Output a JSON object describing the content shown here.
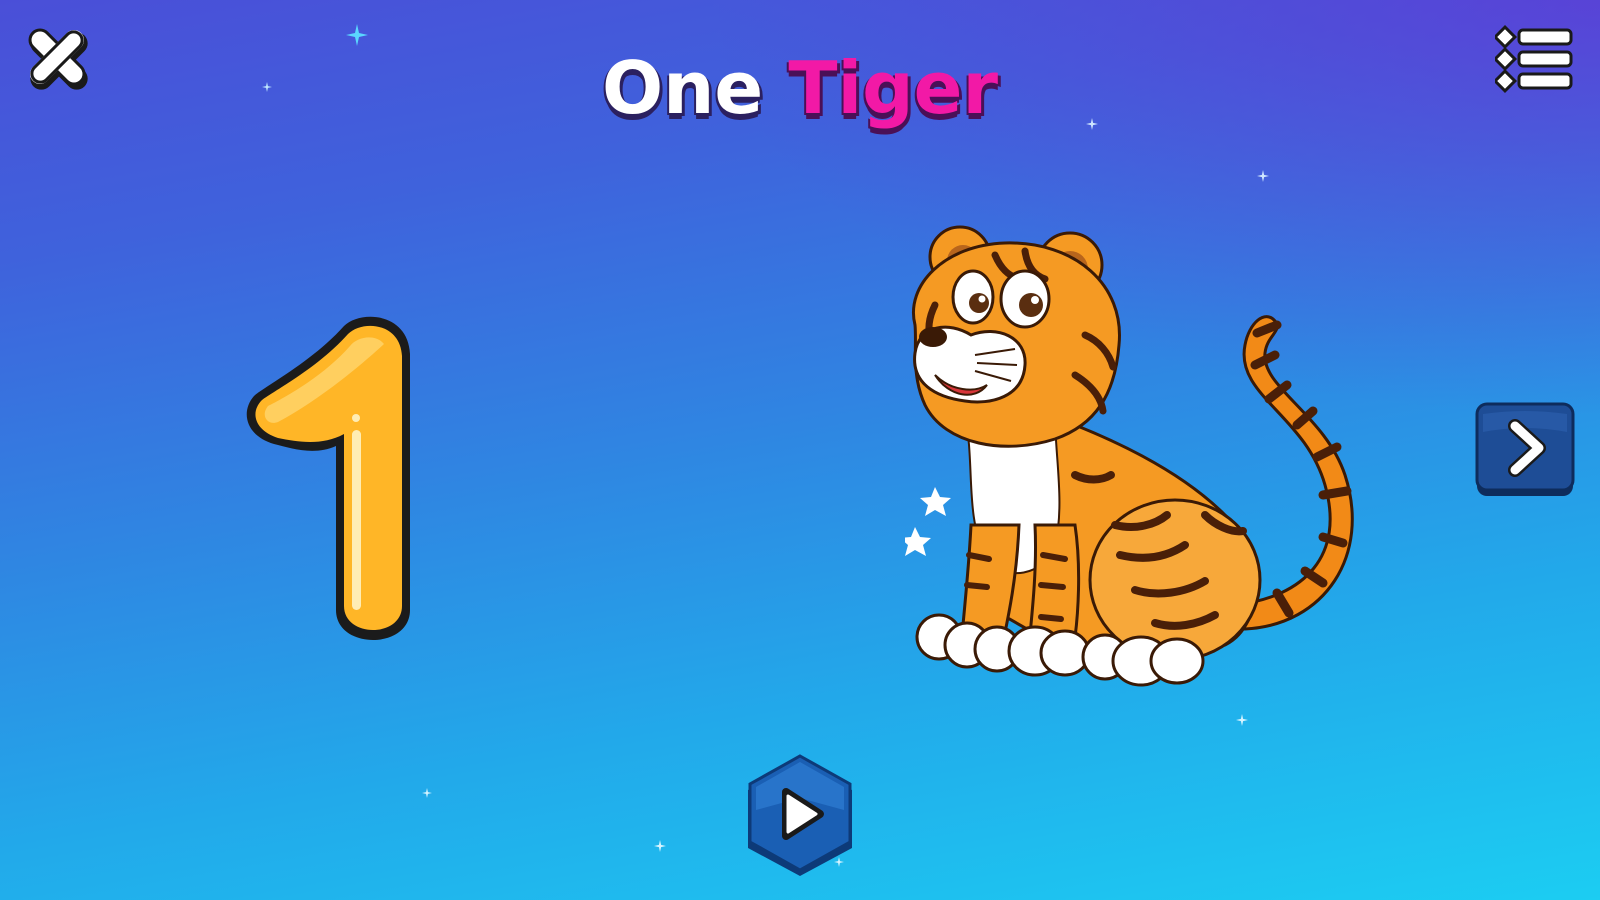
{
  "title": {
    "word_one": "One",
    "word_two": "Tiger",
    "word_one_color": "#ffffff",
    "word_two_color": "#f219a6"
  },
  "numeral": {
    "value": "1",
    "fill_color": "#ffb627"
  },
  "illustration": {
    "subject": "tiger"
  },
  "controls": {
    "close_icon": "close-icon",
    "menu_icon": "list-menu-icon",
    "next_icon": "chevron-right-icon",
    "play_icon": "play-icon"
  },
  "colors": {
    "background_top": "#4a4fd8",
    "background_bottom": "#1ccdf2",
    "button_blue": "#1e4d96"
  }
}
